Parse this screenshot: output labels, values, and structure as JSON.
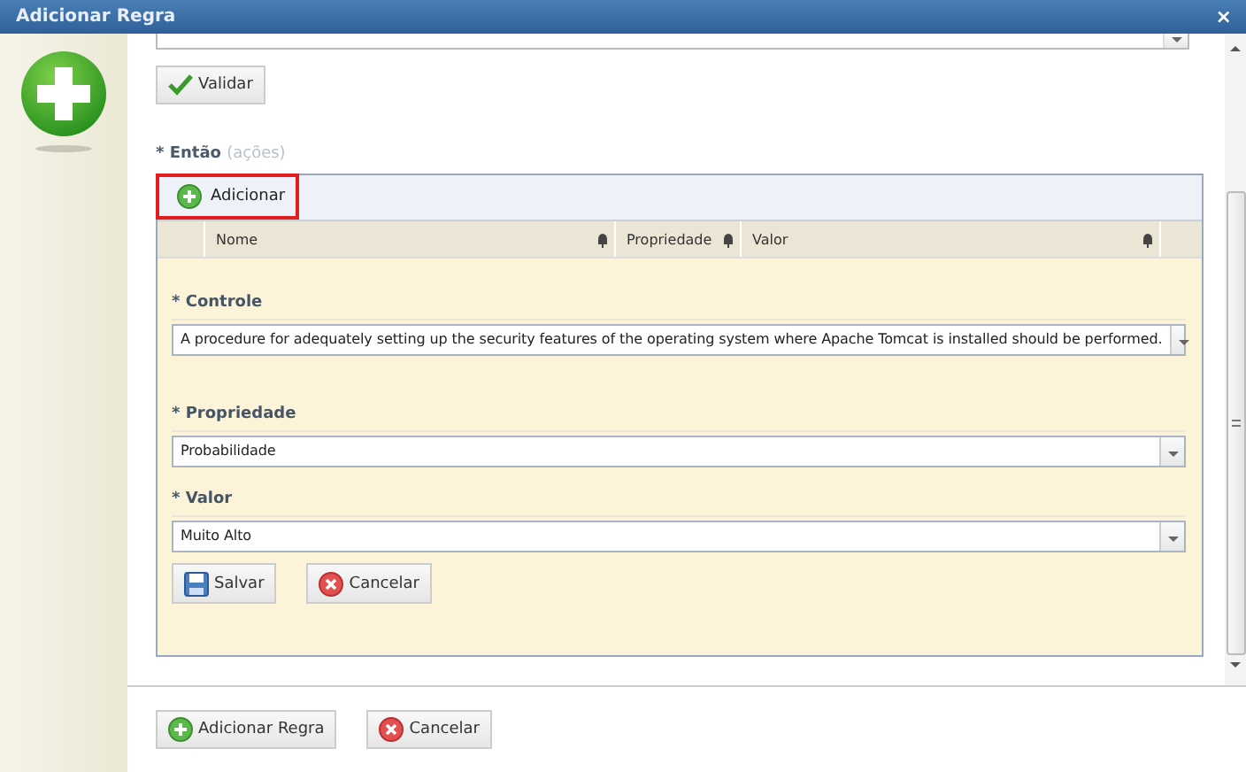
{
  "window": {
    "title": "Adicionar Regra",
    "close": "×"
  },
  "validate_button": "Validar",
  "section": {
    "label": "* Então",
    "hint": "(ações)"
  },
  "grid": {
    "toolbar_button": "Adicionar",
    "toolbar_button_highlighted": true,
    "columns": [
      {
        "label": "Nome",
        "filter": true
      },
      {
        "label": "Propriedade",
        "filter": true
      },
      {
        "label": "Valor",
        "filter": true
      }
    ]
  },
  "form": {
    "fields": [
      {
        "label": "* Controle",
        "value": "A procedure for adequately setting up the security features of the operating system where Apache Tomcat is installed should be performed."
      },
      {
        "label": "* Propriedade",
        "value": "Probabilidade"
      },
      {
        "label": "* Valor",
        "value": "Muito Alto"
      }
    ],
    "buttons": [
      {
        "kind": "save",
        "label": "Salvar"
      },
      {
        "kind": "cancel",
        "label": "Cancelar"
      }
    ]
  },
  "footer_buttons": [
    {
      "kind": "add",
      "label": "Adicionar Regra"
    },
    {
      "kind": "cancel",
      "label": "Cancelar"
    }
  ]
}
